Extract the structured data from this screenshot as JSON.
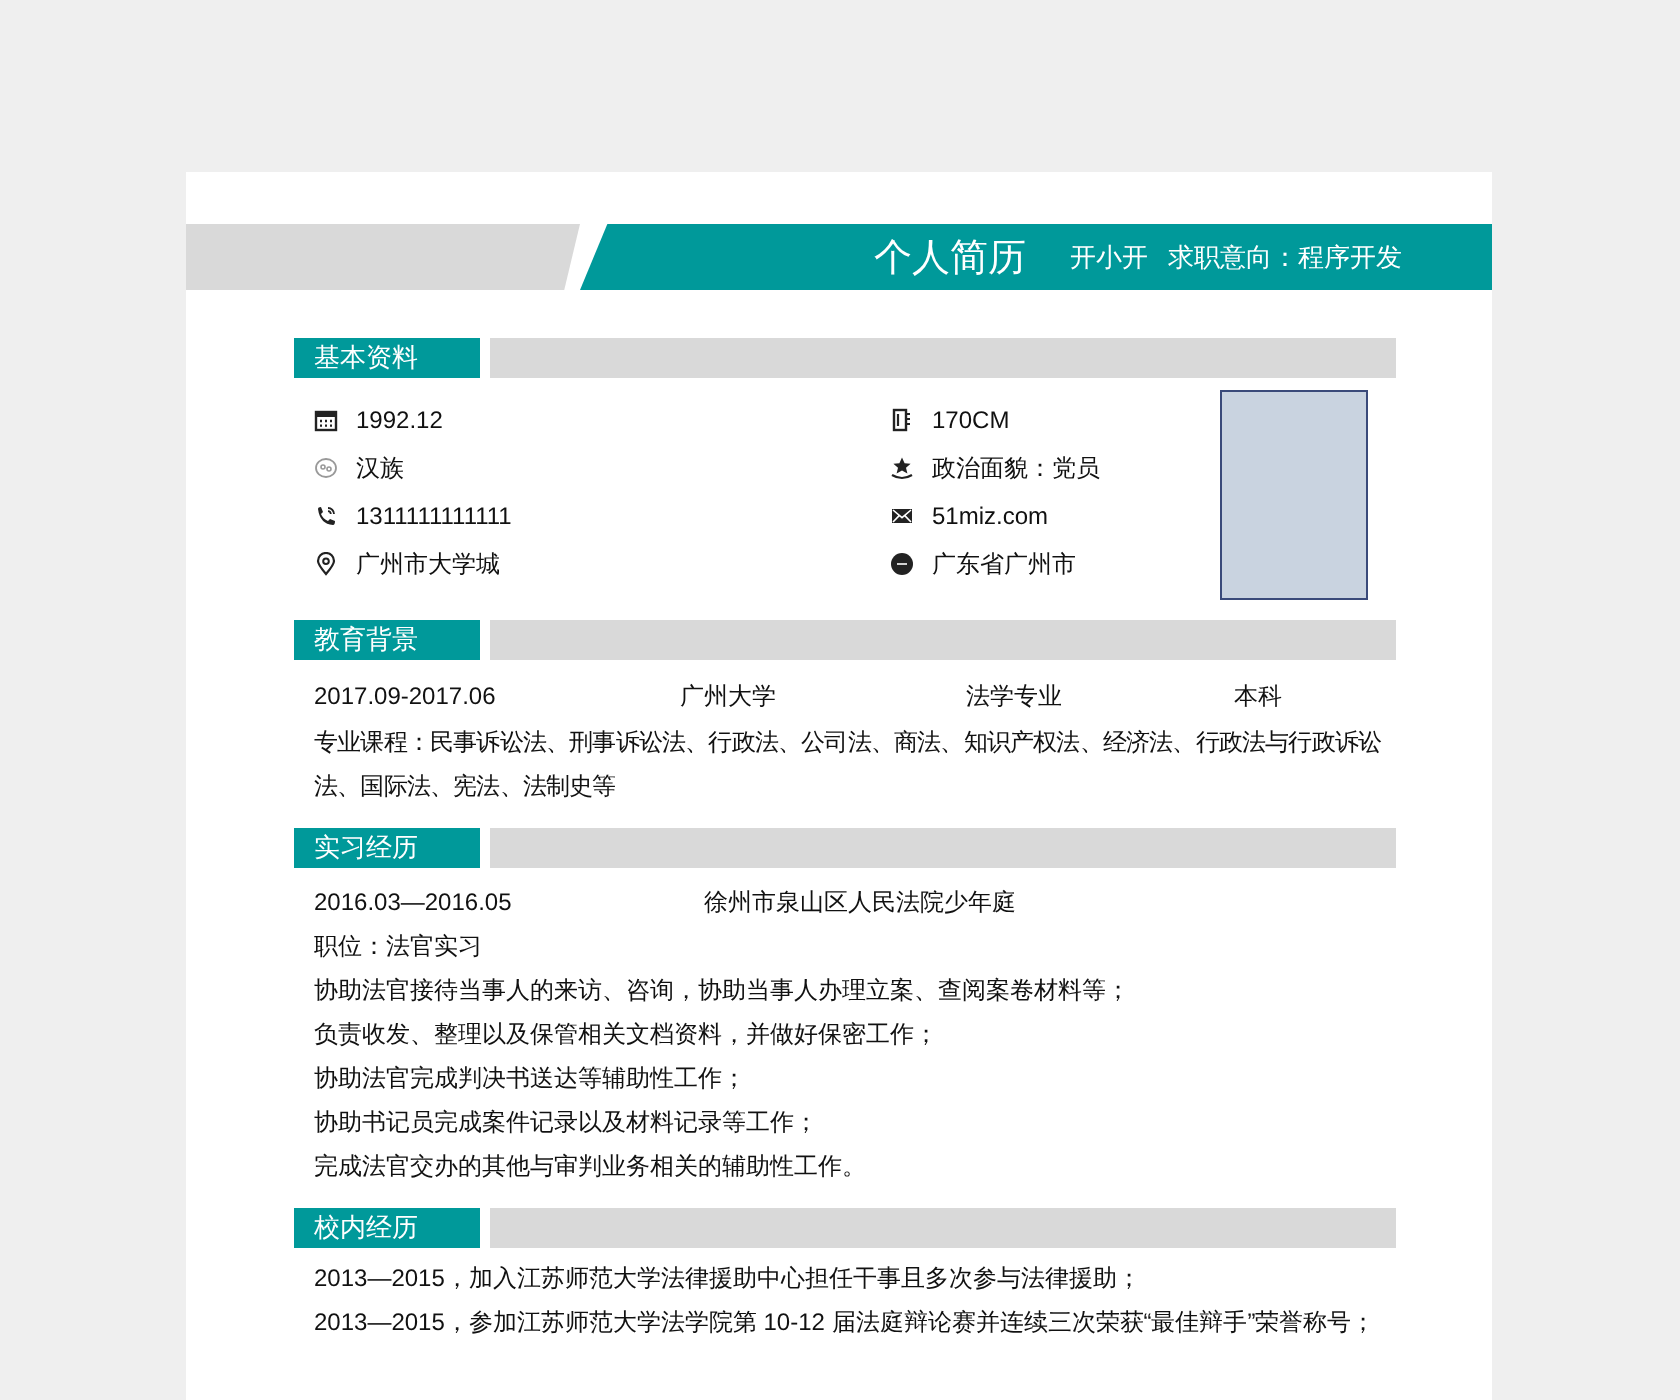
{
  "header": {
    "title": "个人简历",
    "name": "开小开",
    "intention": "求职意向：程序开发"
  },
  "basic_info": {
    "heading": "基本资料",
    "left": [
      {
        "kind": "calendar",
        "text": "1992.12"
      },
      {
        "kind": "ethnicity",
        "text": "汉族"
      },
      {
        "kind": "phone",
        "text": "1311111111111"
      },
      {
        "kind": "location",
        "text": "广州市大学城"
      }
    ],
    "right": [
      {
        "kind": "height",
        "text": "170CM"
      },
      {
        "kind": "politics",
        "text": "政治面貌：党员"
      },
      {
        "kind": "email",
        "text": "51miz.com"
      },
      {
        "kind": "hometown",
        "text": "广东省广州市"
      }
    ]
  },
  "education": {
    "heading": "教育背景",
    "period": "2017.09-2017.06",
    "school": "广州大学",
    "major": "法学专业",
    "degree": "本科",
    "courses": "专业课程：民事诉讼法、刑事诉讼法、行政法、公司法、商法、知识产权法、经济法、行政法与行政诉讼法、国际法、宪法、法制史等"
  },
  "internship": {
    "heading": "实习经历",
    "period": "2016.03—2016.05",
    "employer": "徐州市泉山区人民法院少年庭",
    "lines": [
      "职位：法官实习",
      "协助法官接待当事人的来访、咨询，协助当事人办理立案、查阅案卷材料等；",
      "负责收发、整理以及保管相关文档资料，并做好保密工作；",
      "协助法官完成判决书送达等辅助性工作；",
      "协助书记员完成案件记录以及材料记录等工作；",
      "完成法官交办的其他与审判业务相关的辅助性工作。"
    ]
  },
  "campus": {
    "heading": "校内经历",
    "lines": [
      "2013—2015，加入江苏师范大学法律援助中心担任干事且多次参与法律援助；",
      "2013—2015，参加江苏师范大学法学院第 10-12 届法庭辩论赛并连续三次荣获“最佳辩手”荣誉称号；"
    ]
  }
}
